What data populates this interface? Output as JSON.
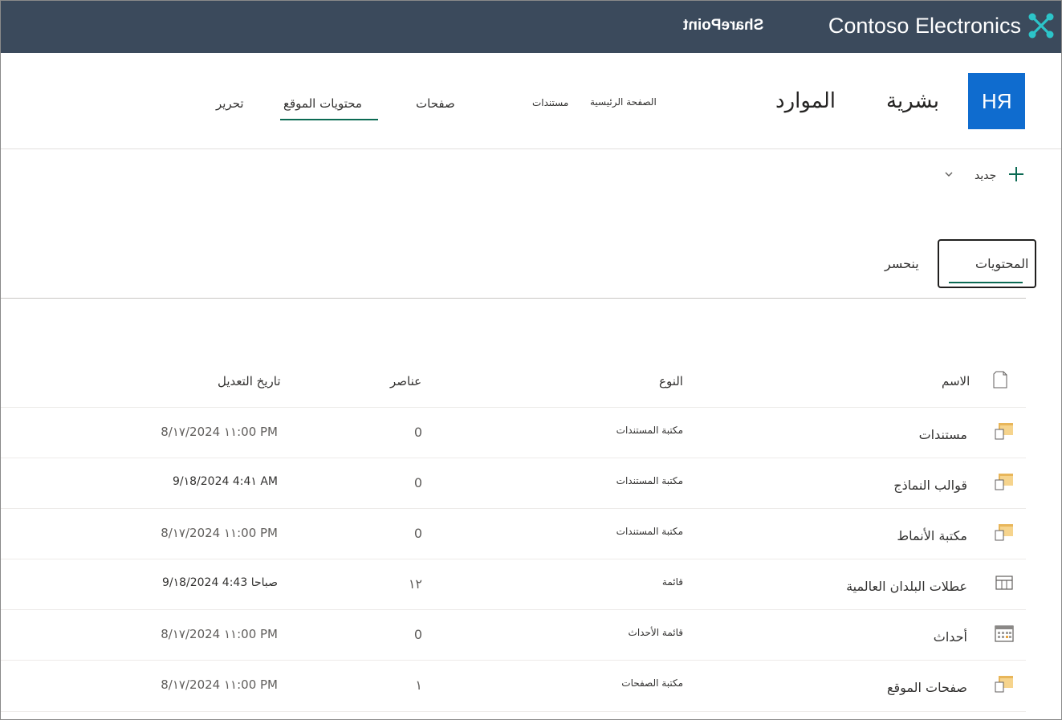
{
  "suite": {
    "brand": "Contoso Electronics",
    "product": "SharePoint",
    "icon": "waffle-x-icon",
    "bg_color": "#3b4a5c"
  },
  "site": {
    "logo_text": "RH",
    "title_part1": "بشرية",
    "title_part2": "الموارد",
    "nav": {
      "home": "الصفحة الرئيسية",
      "documents": "مستندات",
      "pages": "صفحات",
      "site_contents": "محتويات الموقع",
      "edit": "تحرير"
    }
  },
  "command_bar": {
    "new_label": "جديد"
  },
  "pivots": {
    "contents": "المحتويات",
    "recycle_bin": "ينحسر"
  },
  "table": {
    "headers": {
      "name": "الاسم",
      "type": "النوع",
      "items": "عناصر",
      "modified": "تاريخ التعديل"
    },
    "rows": [
      {
        "name": "مستندات",
        "type": "مكتبة المستندات",
        "items": "0",
        "modified": "8/١٧/2024 ١١:00 PM",
        "icon": "document-library-icon"
      },
      {
        "name": "قوالب النماذج",
        "type": "مكتبة المستندات",
        "items": "0",
        "modified": "9/١8/2024 4:4١ AM",
        "icon": "document-library-icon"
      },
      {
        "name": "مكتبة الأنماط",
        "type": "مكتبة المستندات",
        "items": "0",
        "modified": "8/١٧/2024 ١١:00 PM",
        "icon": "document-library-icon"
      },
      {
        "name": "عطلات البلدان العالمية",
        "type": "قائمة",
        "items": "١٢",
        "modified": "9/١8/2024 4:43 صباحا",
        "icon": "list-icon"
      },
      {
        "name": "أحداث",
        "type": "قائمة الأحداث",
        "items": "0",
        "modified": "8/١٧/2024 ١١:00 PM",
        "icon": "calendar-icon"
      },
      {
        "name": "صفحات الموقع",
        "type": "مكتبة الصفحات",
        "items": "١",
        "modified": "8/١٧/2024 ١١:00 PM",
        "icon": "document-library-icon"
      }
    ]
  },
  "colors": {
    "accent": "#0b6a53",
    "logo_bg": "#0f6ccf"
  }
}
